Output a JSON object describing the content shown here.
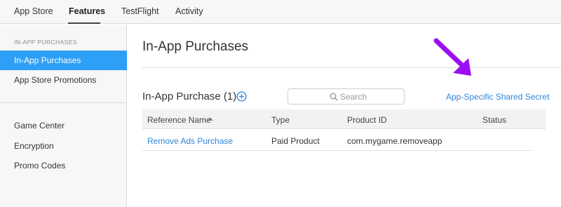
{
  "topnav": {
    "tabs": [
      {
        "label": "App Store"
      },
      {
        "label": "Features"
      },
      {
        "label": "TestFlight"
      },
      {
        "label": "Activity"
      }
    ],
    "active": "Features"
  },
  "sidebar": {
    "section_title": "IN-APP PURCHASES",
    "items": [
      {
        "label": "In-App Purchases"
      },
      {
        "label": "App Store Promotions"
      },
      {
        "label": "Game Center"
      },
      {
        "label": "Encryption"
      },
      {
        "label": "Promo Codes"
      }
    ],
    "active": "In-App Purchases"
  },
  "main": {
    "page_title": "In-App Purchases",
    "section_title": "In-App Purchase (1)",
    "search": {
      "placeholder": "Search",
      "value": ""
    },
    "secret_link": "App-Specific Shared Secret",
    "table": {
      "columns": [
        "Reference Name",
        "Type",
        "Product ID",
        "Status"
      ],
      "sorted_by": "Reference Name",
      "rows": [
        {
          "reference_name": "Remove Ads Purchase",
          "type": "Paid Product",
          "product_id": "com.mygame.removeapp",
          "status": ""
        }
      ]
    }
  },
  "icons": [
    "add-icon",
    "search-icon",
    "sort-ascending-icon",
    "annotation-arrow-icon"
  ],
  "colors": {
    "accent": "#2e9ff7",
    "link": "#2e86d9",
    "annotation_arrow": "#9b10f2",
    "nav_background": "#f7f7f7"
  }
}
